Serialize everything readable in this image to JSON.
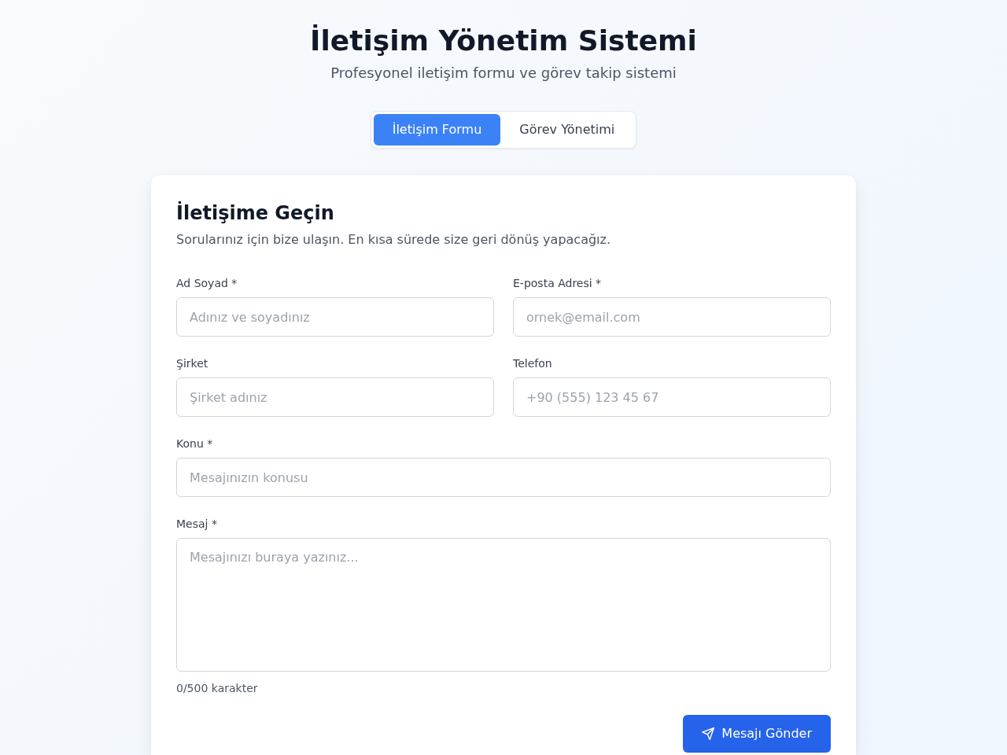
{
  "header": {
    "title": "İletişim Yönetim Sistemi",
    "subtitle": "Profesyonel iletişim formu ve görev takip sistemi"
  },
  "tabs": [
    {
      "label": "İletişim Formu",
      "selected": true
    },
    {
      "label": "Görev Yönetimi",
      "selected": false
    }
  ],
  "form": {
    "title": "İletişime Geçin",
    "description": "Sorularınız için bize ulaşın. En kısa sürede size geri dönüş yapacağız.",
    "rows": [
      [
        {
          "kind": "input",
          "label": "Ad Soyad *",
          "placeholder": "Adınız ve soyadınız"
        },
        {
          "kind": "input",
          "label": "E-posta Adresi *",
          "placeholder": "ornek@email.com"
        }
      ],
      [
        {
          "kind": "input",
          "label": "Şirket",
          "placeholder": "Şirket adınız"
        },
        {
          "kind": "input",
          "label": "Telefon",
          "placeholder": "+90 (555) 123 45 67"
        }
      ],
      [
        {
          "kind": "input",
          "label": "Konu *",
          "placeholder": "Mesajınızın konusu"
        }
      ],
      [
        {
          "kind": "textarea",
          "label": "Mesaj *",
          "placeholder": "Mesajınızı buraya yazınız..."
        }
      ]
    ],
    "counter": "0/500 karakter",
    "submit_button": "Mesajı Gönder"
  }
}
